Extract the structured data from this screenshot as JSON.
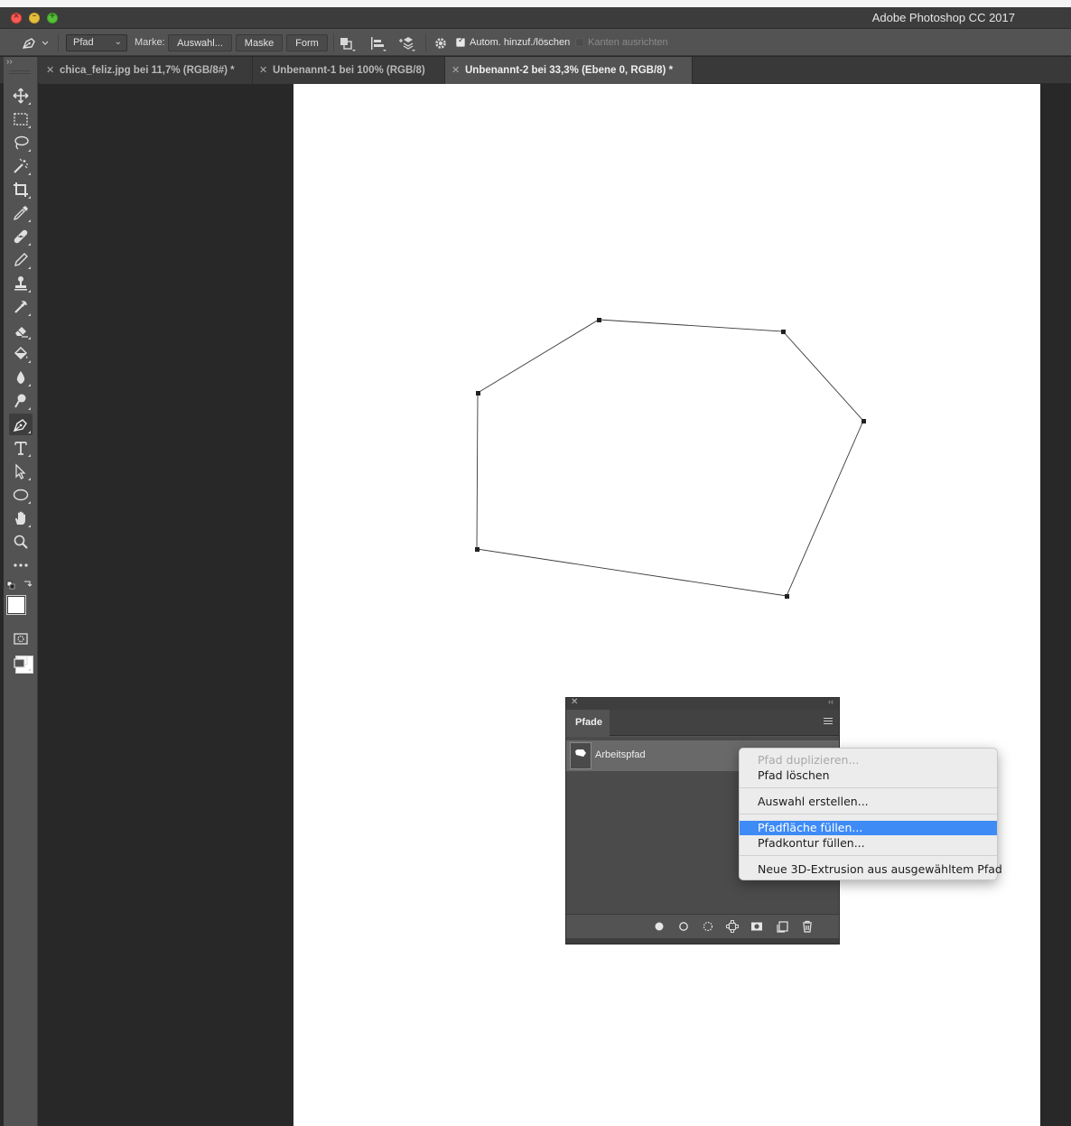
{
  "window": {
    "title": "Adobe Photoshop CC 2017",
    "buttons": [
      "close",
      "minimize",
      "maximize"
    ]
  },
  "options_bar": {
    "mode_select": "Pfad",
    "make_label": "Marke:",
    "selection_button": "Auswahl...",
    "mask_button": "Maske",
    "shape_button": "Form",
    "auto_add_delete": {
      "label": "Autom. hinzuf./löschen",
      "checked": true
    },
    "align_edges": {
      "label": "Kanten ausrichten",
      "checked": false
    }
  },
  "tabs": [
    {
      "label": "chica_feliz.jpg bei 11,7% (RGB/8#) *",
      "active": false
    },
    {
      "label": "Unbenannt-1 bei 100% (RGB/8)",
      "active": false
    },
    {
      "label": "Unbenannt-2 bei 33,3% (Ebene 0, RGB/8) *",
      "active": true
    }
  ],
  "toolbar": {
    "tools": [
      "move",
      "marquee",
      "lasso",
      "magic-wand",
      "crop",
      "eyedropper",
      "healing-brush",
      "brush",
      "clone-stamp",
      "history-brush",
      "eraser",
      "paint-bucket",
      "blur",
      "dodge",
      "pen",
      "type",
      "path-selection",
      "ellipse",
      "hand",
      "zoom",
      "more"
    ],
    "active_tool": "pen",
    "foreground_color": "#ffffff",
    "background_color": "#ffffff"
  },
  "paths_panel": {
    "tab_label": "Pfade",
    "paths": [
      {
        "name": "Arbeitspfad",
        "selected": true
      }
    ],
    "footer_icons": [
      "fill-path",
      "stroke-path",
      "load-as-selection",
      "make-work-path",
      "add-mask",
      "new-path",
      "delete-path"
    ]
  },
  "context_menu": {
    "items": [
      {
        "label": "Pfad duplizieren...",
        "disabled": true,
        "highlighted": false
      },
      {
        "label": "Pfad löschen",
        "disabled": false,
        "highlighted": false
      },
      {
        "separator": true
      },
      {
        "label": "Auswahl erstellen...",
        "disabled": false,
        "highlighted": false
      },
      {
        "separator": true
      },
      {
        "label": "Pfadfläche füllen...",
        "disabled": false,
        "highlighted": true
      },
      {
        "label": "Pfadkontur füllen...",
        "disabled": false,
        "highlighted": false
      },
      {
        "separator": true
      },
      {
        "label": "Neue 3D-Extrusion aus ausgewähltem Pfad",
        "disabled": false,
        "highlighted": false
      }
    ]
  },
  "colors": {
    "accent": "#3e8bf6",
    "ui_dark": "#535353",
    "workspace": "#282828"
  }
}
